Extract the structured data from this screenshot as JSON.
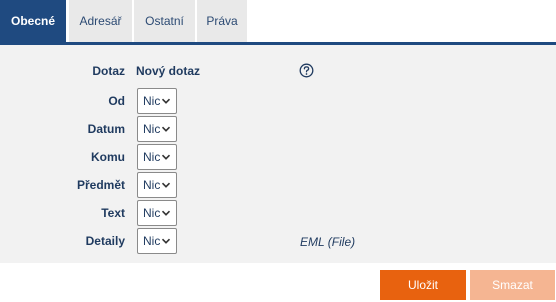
{
  "tabs": [
    {
      "label": "Obecné",
      "active": true
    },
    {
      "label": "Adresář",
      "active": false
    },
    {
      "label": "Ostatní",
      "active": false
    },
    {
      "label": "Práva",
      "active": false
    }
  ],
  "form": {
    "query_label": "Dotaz",
    "query_value": "Nový dotaz",
    "fields": [
      {
        "label": "Od",
        "value": "Nic"
      },
      {
        "label": "Datum",
        "value": "Nic"
      },
      {
        "label": "Komu",
        "value": "Nic"
      },
      {
        "label": "Předmět",
        "value": "Nic"
      },
      {
        "label": "Text",
        "value": "Nic"
      },
      {
        "label": "Detaily",
        "value": "Nic"
      }
    ],
    "details_note": "EML (File)"
  },
  "buttons": {
    "save": "Uložit",
    "delete": "Smazat"
  },
  "colors": {
    "tab_active": "#1f4a80",
    "panel": "#f2f2f2",
    "save": "#e8620f",
    "delete": "#f5b592"
  },
  "icons": {
    "help": "question-circle-icon",
    "select": "chevron-down-icon"
  }
}
